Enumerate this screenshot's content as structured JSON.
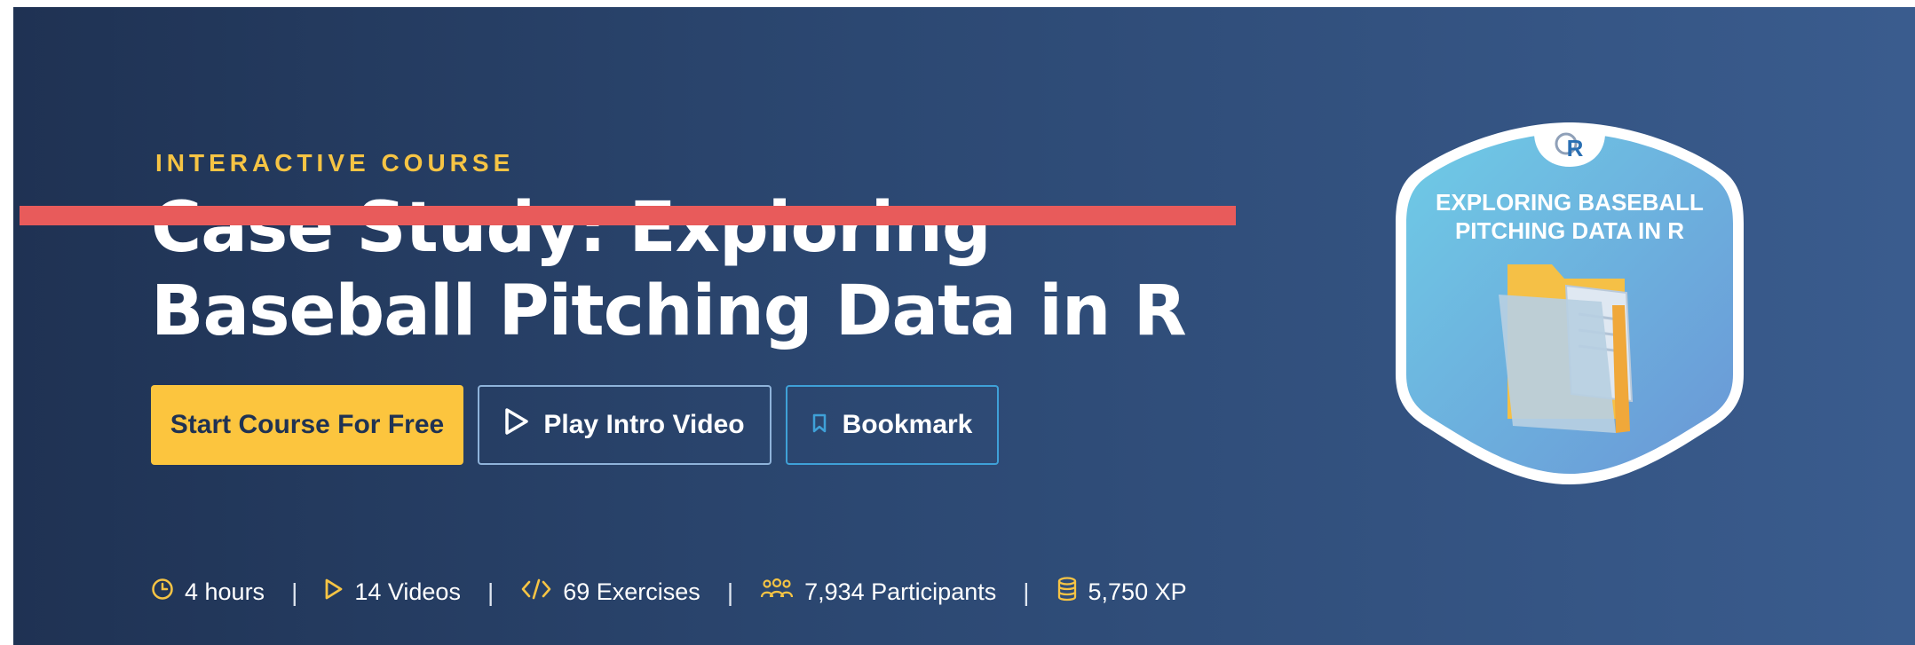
{
  "course": {
    "eyebrow": "INTERACTIVE COURSE",
    "title": "Case Study: Exploring Baseball Pitching Data in R"
  },
  "actions": {
    "start_label": "Start Course For Free",
    "play_label": "Play Intro Video",
    "bookmark_label": "Bookmark"
  },
  "stats": {
    "hours": "4 hours",
    "videos": "14 Videos",
    "exercises": "69 Exercises",
    "participants": "7,934 Participants",
    "xp": "5,750 XP",
    "separator": "|"
  },
  "badge": {
    "logo_text": "R",
    "line1": "EXPLORING BASEBALL",
    "line2": "PITCHING DATA IN R"
  },
  "colors": {
    "accent_yellow": "#fcc53e",
    "eyebrow_yellow": "#f6c444",
    "strike_red": "#e85b5b",
    "bookmark_blue": "#3fa1d8"
  }
}
